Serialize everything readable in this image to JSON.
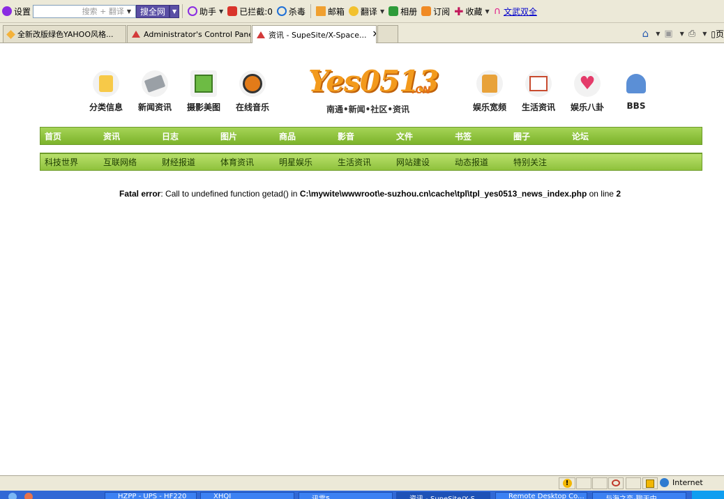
{
  "toolbar": {
    "settings": "设置",
    "search_placeholder": "搜索 + 翻译",
    "search_button": "搜全网",
    "helper": "助手",
    "blocked": "已拦截:0",
    "antivirus": "杀毒",
    "mail": "邮箱",
    "translate": "翻译",
    "album": "相册",
    "subscribe": "订阅",
    "favorites": "收藏",
    "link": "文武双全"
  },
  "tabs": [
    {
      "label": "全新改版绿色YAHOO风格...",
      "color": "#f4b23a"
    },
    {
      "label": "Administrator's Control Panel",
      "color": "#d33a3a"
    },
    {
      "label": "资讯 - SupeSite/X-Space...",
      "color": "#d33a3a",
      "active": true
    }
  ],
  "right_tools": {
    "page": "页"
  },
  "site": {
    "logo": "Yes0513",
    "logo_tld": ".CN",
    "slogan": "南通•新闻•社区•资讯",
    "left_icons": [
      {
        "label": "分类信息",
        "icon": "shopping-bag-icon",
        "color": "#f7c948"
      },
      {
        "label": "新闻资讯",
        "icon": "newspaper-icon",
        "color": "#9aa0a6"
      },
      {
        "label": "摄影美图",
        "icon": "picture-icon",
        "color": "#6dbb44"
      },
      {
        "label": "在线音乐",
        "icon": "headphones-icon",
        "color": "#e27b19"
      }
    ],
    "right_icons": [
      {
        "label": "娱乐宽频",
        "icon": "popcorn-icon",
        "color": "#e8a23a"
      },
      {
        "label": "生活资讯",
        "icon": "chart-icon",
        "color": "#c84b2f"
      },
      {
        "label": "娱乐八卦",
        "icon": "heart-icon",
        "color": "#e43b6a"
      },
      {
        "label": "BBS",
        "icon": "people-icon",
        "color": "#5b8fd6"
      }
    ],
    "main_menu": [
      "首页",
      "资讯",
      "日志",
      "图片",
      "商品",
      "影音",
      "文件",
      "书签",
      "圈子",
      "论坛"
    ],
    "sub_menu": [
      "科技世界",
      "互联网络",
      "财经报道",
      "体育资讯",
      "明星娱乐",
      "生活资讯",
      "网站建设",
      "动态报道",
      "特别关注"
    ]
  },
  "error": {
    "label": "Fatal error",
    "message": ": Call to undefined function getad() in ",
    "path": "C:\\mywite\\wwwroot\\e-suzhou.cn\\cache\\tpl\\tpl_yes0513_news_index.php",
    "line_text": " on line ",
    "line": "2"
  },
  "status": {
    "zone": "Internet"
  },
  "taskbar": [
    "HZPP - UPS - HF220",
    "XHQI",
    "讯雷5",
    "资讯 - SupeSite/X-S...",
    "Remote Desktop Co...",
    "与海之恋-聊天中..."
  ]
}
